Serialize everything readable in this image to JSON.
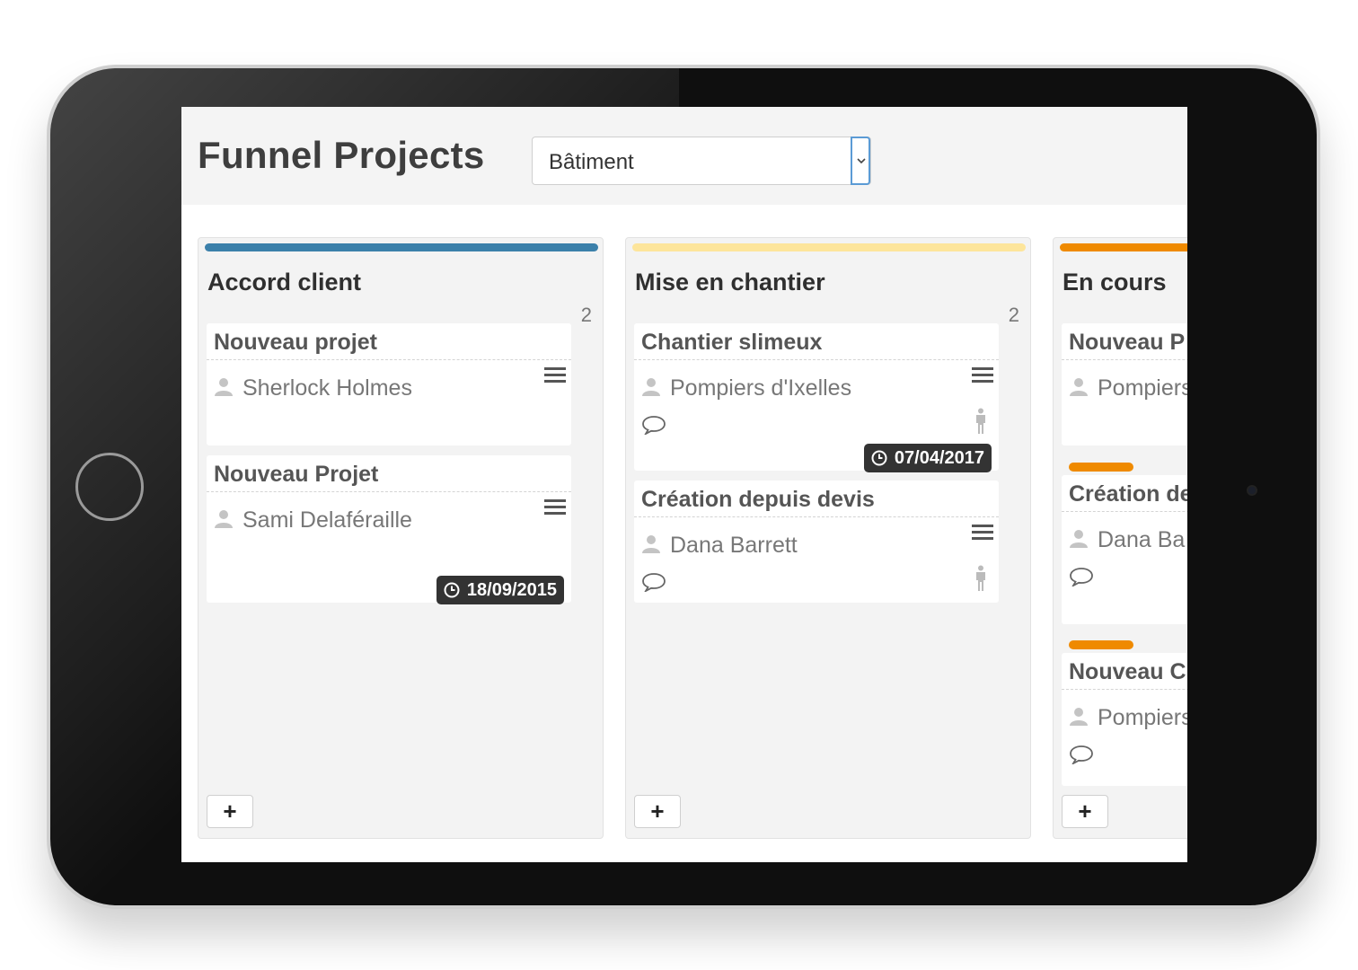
{
  "header": {
    "title": "Funnel Projects",
    "filter_value": "Bâtiment"
  },
  "colors": {
    "accord": "#3b80aa",
    "chantier": "#fde59b",
    "en_cours": "#ef8a00"
  },
  "columns": [
    {
      "title": "Accord client",
      "count": "2",
      "add_label": "+",
      "cards": [
        {
          "title": "Nouveau projet",
          "person": "Sherlock Holmes"
        },
        {
          "title": "Nouveau Projet",
          "person": "Sami Delaféraille",
          "date": "18/09/2015"
        }
      ]
    },
    {
      "title": "Mise en chantier",
      "count": "2",
      "add_label": "+",
      "cards": [
        {
          "title": "Chantier slimeux",
          "person": "Pompiers d'Ixelles",
          "date": "07/04/2017"
        },
        {
          "title": "Création depuis devis",
          "person": "Dana Barrett"
        }
      ]
    },
    {
      "title": "En cours",
      "add_label": "+",
      "cards": [
        {
          "title": "Nouveau P",
          "person": "Pompiers"
        },
        {
          "title": "Création de",
          "person": "Dana Ba"
        },
        {
          "title": "Nouveau C",
          "person": "Pompiers"
        }
      ]
    }
  ]
}
